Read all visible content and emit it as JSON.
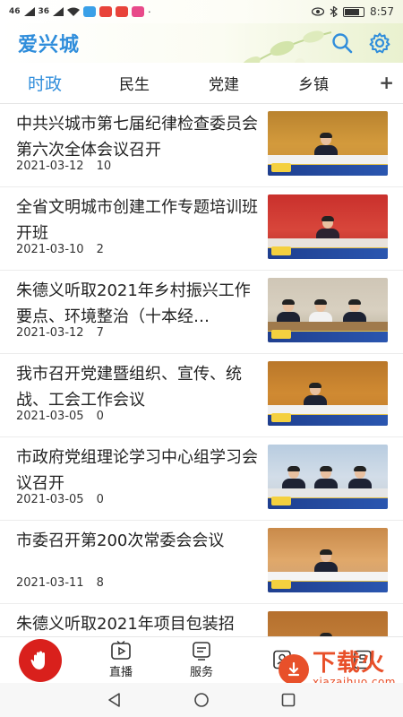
{
  "status_bar": {
    "signal_1": "46",
    "signal_2": "36",
    "time": "8:57"
  },
  "header": {
    "title": "爱兴城",
    "icons": [
      "search-icon",
      "gear-icon"
    ],
    "accent_color": "#2f8ddb"
  },
  "tabs": {
    "items": [
      {
        "label": "时政",
        "active": true
      },
      {
        "label": "民生",
        "active": false
      },
      {
        "label": "党建",
        "active": false
      },
      {
        "label": "乡镇",
        "active": false
      }
    ],
    "add_label": "+"
  },
  "news": [
    {
      "title": "中共兴城市第七届纪律检查委员会第六次全体会议召开",
      "date": "2021-03-12",
      "count": "10"
    },
    {
      "title": "全省文明城市创建工作专题培训班开班",
      "date": "2021-03-10",
      "count": "2"
    },
    {
      "title": "朱德义听取2021年乡村振兴工作要点、环境整治（十本经…",
      "date": "2021-03-12",
      "count": "7"
    },
    {
      "title": "我市召开党建暨组织、宣传、统战、工会工作会议",
      "date": "2021-03-05",
      "count": "0"
    },
    {
      "title": "市政府党组理论学习中心组学习会议召开",
      "date": "2021-03-05",
      "count": "0"
    },
    {
      "title": "市委召开第200次常委会会议",
      "date": "2021-03-11",
      "count": "8"
    },
    {
      "title": "朱德义听取2021年项目包装招",
      "date": "",
      "count": ""
    }
  ],
  "bottom_nav": {
    "items": [
      {
        "label": "",
        "icon": "hand-icon"
      },
      {
        "label": "直播",
        "icon": "live-icon"
      },
      {
        "label": "服务",
        "icon": "service-icon"
      },
      {
        "label": "",
        "icon": "contacts-icon"
      },
      {
        "label": "",
        "icon": "profile-icon"
      }
    ],
    "home_color": "#d9201c"
  },
  "watermark": {
    "main": "下载火",
    "sub": "xiazaihuo.com"
  }
}
